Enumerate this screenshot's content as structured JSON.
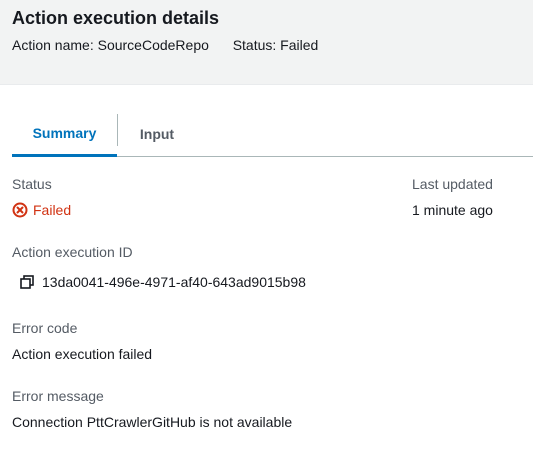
{
  "header": {
    "title": "Action execution details",
    "action_name_label": "Action name:",
    "action_name_value": "SourceCodeRepo",
    "status_label": "Status:",
    "status_value": "Failed"
  },
  "tabs": [
    {
      "label": "Summary",
      "active": true
    },
    {
      "label": "Input",
      "active": false
    }
  ],
  "summary": {
    "status_label": "Status",
    "status_value": "Failed",
    "last_updated_label": "Last updated",
    "last_updated_value": "1 minute ago",
    "execution_id_label": "Action execution ID",
    "execution_id_value": "13da0041-496e-4971-af40-643ad9015b98",
    "error_code_label": "Error code",
    "error_code_value": "Action execution failed",
    "error_message_label": "Error message",
    "error_message_value": "Connection PttCrawlerGitHub is not available"
  },
  "colors": {
    "header_bg": "#f2f3f3",
    "accent": "#0073bb",
    "error": "#d13212",
    "label": "#545b64",
    "text": "#16191f"
  },
  "icons": {
    "status": "error-circle-x-icon",
    "copy": "copy-icon"
  }
}
